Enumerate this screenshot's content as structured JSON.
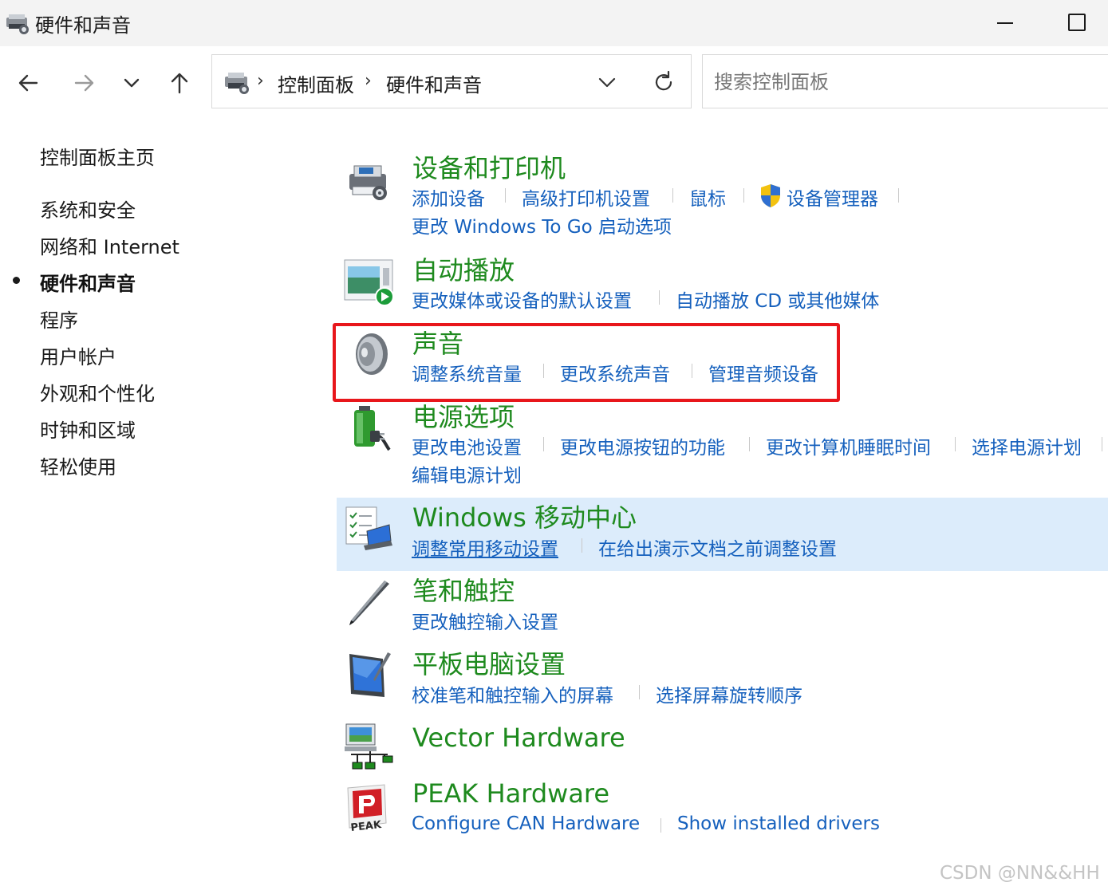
{
  "window": {
    "title": "硬件和声音"
  },
  "address": {
    "crumbs": [
      "控制面板",
      "硬件和声音"
    ]
  },
  "search": {
    "placeholder": "搜索控制面板"
  },
  "sidebar": {
    "home": "控制面板主页",
    "items": [
      {
        "label": "系统和安全"
      },
      {
        "label": "网络和 Internet"
      },
      {
        "label": "硬件和声音",
        "active": true
      },
      {
        "label": "程序"
      },
      {
        "label": "用户帐户"
      },
      {
        "label": "外观和个性化"
      },
      {
        "label": "时钟和区域"
      },
      {
        "label": "轻松使用"
      }
    ]
  },
  "categories": [
    {
      "title": "设备和打印机",
      "icon": "printer-icon",
      "links": [
        "添加设备",
        "高级打印机设置",
        "鼠标",
        "设备管理器",
        "更改 Windows To Go 启动选项"
      ]
    },
    {
      "title": "自动播放",
      "icon": "autoplay-icon",
      "links": [
        "更改媒体或设备的默认设置",
        "自动播放 CD 或其他媒体"
      ]
    },
    {
      "title": "声音",
      "icon": "speaker-icon",
      "highlighted": true,
      "links": [
        "调整系统音量",
        "更改系统声音",
        "管理音频设备"
      ]
    },
    {
      "title": "电源选项",
      "icon": "battery-plug-icon",
      "links": [
        "更改电池设置",
        "更改电源按钮的功能",
        "更改计算机睡眠时间",
        "选择电源计划",
        "编辑电源计划"
      ]
    },
    {
      "title": "Windows 移动中心",
      "icon": "mobility-center-icon",
      "hovered": true,
      "links": [
        "调整常用移动设置",
        "在给出演示文档之前调整设置"
      ]
    },
    {
      "title": "笔和触控",
      "icon": "pen-icon",
      "links": [
        "更改触控输入设置"
      ]
    },
    {
      "title": "平板电脑设置",
      "icon": "tablet-icon",
      "links": [
        "校准笔和触控输入的屏幕",
        "选择屏幕旋转顺序"
      ]
    },
    {
      "title": "Vector Hardware",
      "icon": "network-computer-icon",
      "links": []
    },
    {
      "title": "PEAK Hardware",
      "icon": "peak-logo-icon",
      "links": [
        "Configure CAN Hardware",
        "Show installed drivers"
      ]
    }
  ],
  "colors": {
    "category_title": "#1e8a1e",
    "link": "#1560bd",
    "highlight_border": "#e8161b",
    "hover_bg": "#dcecfb"
  },
  "watermark": "CSDN @NN&&HH"
}
